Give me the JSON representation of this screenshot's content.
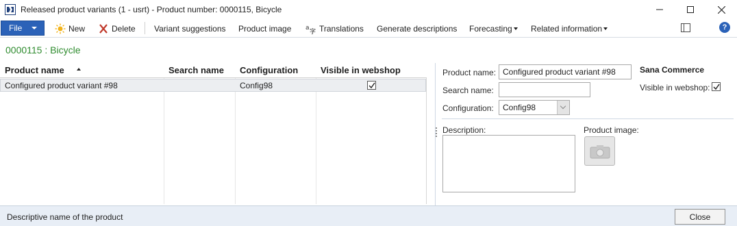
{
  "window": {
    "title": "Released product variants (1 - usrt) - Product number: 0000115, Bicycle",
    "app_icon": "dynamics-ax-icon",
    "controls": [
      "minimize-icon",
      "maximize-icon",
      "close-icon"
    ]
  },
  "ribbon": {
    "file_label": "File",
    "items": {
      "new": "New",
      "delete": "Delete",
      "variant_suggestions": "Variant suggestions",
      "product_image": "Product image",
      "translations": "Translations",
      "generate_descriptions": "Generate descriptions",
      "forecasting": "Forecasting",
      "related_information": "Related information"
    },
    "help_glyph": "?"
  },
  "header": {
    "title": "0000115 : Bicycle"
  },
  "grid": {
    "columns": [
      "Product name",
      "Search name",
      "Configuration",
      "Visible in webshop"
    ],
    "sort_column": "Product name",
    "sort_direction": "ascending",
    "rows": [
      {
        "product_name": "Configured product variant #98",
        "search_name": "",
        "configuration": "Config98",
        "visible_in_webshop": true
      }
    ]
  },
  "details": {
    "product_name_label": "Product name:",
    "product_name_value": "Configured product variant #98",
    "search_name_label": "Search name:",
    "search_name_value": "",
    "configuration_label": "Configuration:",
    "configuration_value": "Config98",
    "group_title": "Sana Commerce",
    "visible_label": "Visible in webshop:",
    "visible_checked": true,
    "description_label": "Description:",
    "description_value": "",
    "product_image_label": "Product image:"
  },
  "statusbar": {
    "text": "Descriptive name of the product",
    "close_label": "Close"
  },
  "colors": {
    "accent": "#2b62b8",
    "header_green": "#2e8b2e",
    "statusbar_bg": "#e8eef6"
  }
}
